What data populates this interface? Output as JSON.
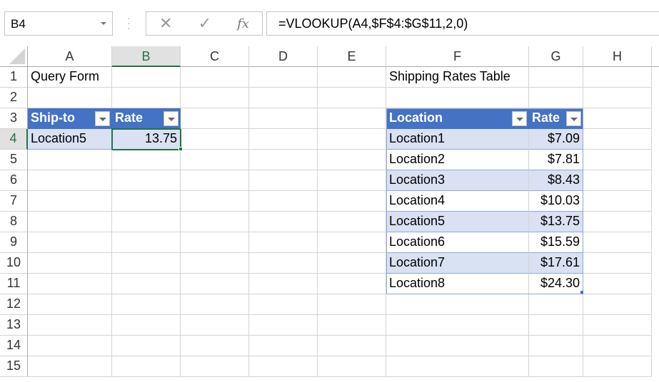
{
  "name_box": "B4",
  "formula": "=VLOOKUP(A4,$F$4:$G$11,2,0)",
  "formula_buttons": {
    "cancel": "✕",
    "enter": "✓",
    "fx": "fx"
  },
  "columns": [
    "A",
    "B",
    "C",
    "D",
    "E",
    "F",
    "G",
    "H"
  ],
  "rows": [
    "1",
    "2",
    "3",
    "4",
    "5",
    "6",
    "7",
    "8",
    "9",
    "10",
    "11",
    "12",
    "13",
    "14",
    "15"
  ],
  "query_form": {
    "title": "Query Form",
    "headers": [
      "Ship-to",
      "Rate"
    ],
    "ship_to": "Location5",
    "rate": "13.75"
  },
  "rates_table": {
    "title": "Shipping Rates Table",
    "headers": [
      "Location",
      "Rate"
    ],
    "rows": [
      [
        "Location1",
        "$7.09"
      ],
      [
        "Location2",
        "$7.81"
      ],
      [
        "Location3",
        "$8.43"
      ],
      [
        "Location4",
        "$10.03"
      ],
      [
        "Location5",
        "$13.75"
      ],
      [
        "Location6",
        "$15.59"
      ],
      [
        "Location7",
        "$17.61"
      ],
      [
        "Location8",
        "$24.30"
      ]
    ]
  },
  "colors": {
    "header": "#4472c4",
    "band": "#d9e1f2",
    "select": "#217346"
  }
}
